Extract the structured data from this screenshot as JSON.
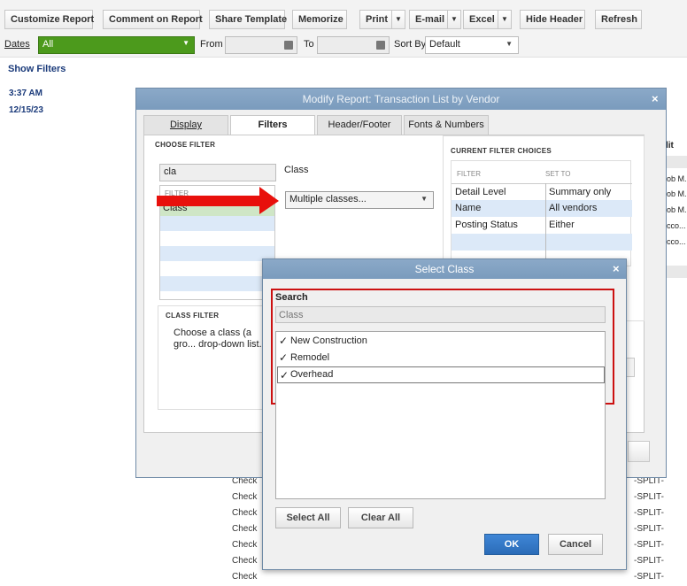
{
  "toolbar": {
    "customize": "Customize Report",
    "comment": "Comment on Report",
    "share": "Share Template",
    "memorize": "Memorize",
    "print": "Print",
    "email": "E-mail",
    "excel": "Excel",
    "hide_header": "Hide Header",
    "refresh": "Refresh"
  },
  "filterbar": {
    "dates_label": "Dates",
    "dates_value": "All",
    "from_label": "From",
    "to_label": "To",
    "sort_label": "Sort By",
    "sort_value": "Default",
    "accent": "#4c9a1c"
  },
  "show_filters": "Show Filters",
  "report_meta": {
    "time": "3:37 AM",
    "date": "12/15/23"
  },
  "background_report": {
    "right_header": "lit",
    "right_cells": [
      "ob M.",
      "ob M.",
      "ob M.",
      "cco...",
      "cco..."
    ],
    "rows": [
      {
        "type": "Check",
        "split": "-SPLIT-"
      },
      {
        "type": "Check",
        "split": "-SPLIT-"
      },
      {
        "type": "Check",
        "split": "-SPLIT-"
      },
      {
        "type": "Check",
        "split": "-SPLIT-"
      },
      {
        "type": "Check",
        "split": "-SPLIT-"
      },
      {
        "type": "Check",
        "split": "-SPLIT-"
      },
      {
        "type": "Check",
        "split": "-SPLIT-"
      }
    ]
  },
  "modify_dialog": {
    "title": "Modify Report: Transaction List by Vendor",
    "tabs": [
      "Display",
      "Filters",
      "Header/Footer",
      "Fonts & Numbers"
    ],
    "active_tab": "Filters",
    "choose_filter_heading": "CHOOSE FILTER",
    "search_value": "cla",
    "filter_col_label": "FILTER",
    "filter_list": [
      "Class"
    ],
    "selected_filter_name": "Class",
    "class_dropdown_value": "Multiple classes...",
    "arrow_color": "#e8100c",
    "current_heading": "CURRENT FILTER CHOICES",
    "current_cols": [
      "FILTER",
      "SET TO"
    ],
    "current_rows": [
      {
        "filter": "Detail Level",
        "set_to": "Summary only"
      },
      {
        "filter": "Name",
        "set_to": "All vendors"
      },
      {
        "filter": "Posting Status",
        "set_to": "Either"
      }
    ],
    "class_filter_heading": "CLASS FILTER",
    "class_filter_text": "Choose a class (a gro... drop-down list."
  },
  "select_class_dialog": {
    "title": "Select Class",
    "search_label": "Search",
    "search_placeholder": "Class",
    "classes": [
      {
        "name": "New Construction",
        "checked": true
      },
      {
        "name": "Remodel",
        "checked": true
      },
      {
        "name": "Overhead",
        "checked": true
      }
    ],
    "check_glyph": "✓",
    "select_all": "Select All",
    "clear_all": "Clear All",
    "ok": "OK",
    "cancel": "Cancel",
    "highlight_color": "#cc1111",
    "ok_color": "#2f74c4"
  }
}
